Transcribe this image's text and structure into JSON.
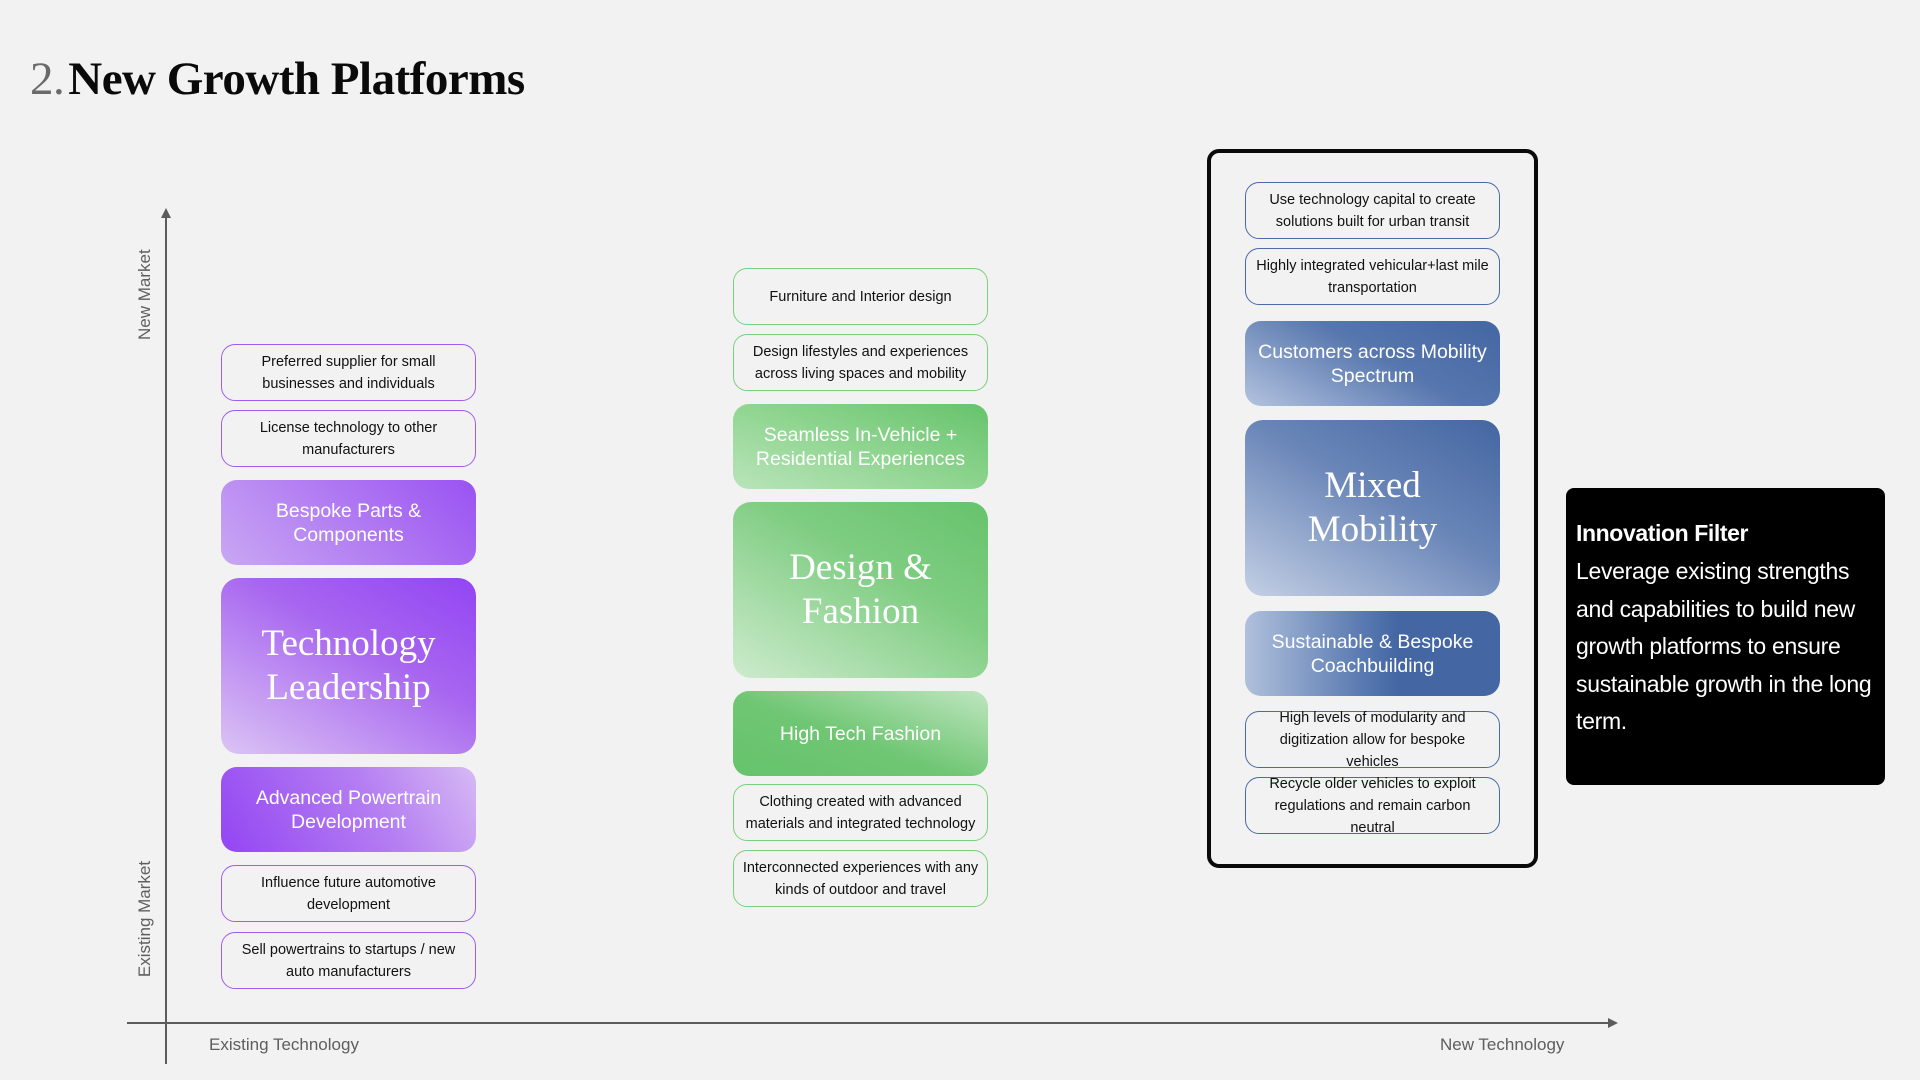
{
  "title": {
    "number": "2.",
    "text": "New Growth Platforms"
  },
  "axes": {
    "y_top_label": "New Market",
    "y_bottom_label": "Existing Market",
    "x_left_label": "Existing Technology",
    "x_right_label": "New Technology"
  },
  "columns": [
    {
      "name": "Technology Leadership",
      "color": "#9345f3",
      "items": [
        {
          "kind": "small",
          "text": "Preferred supplier for small businesses and individuals"
        },
        {
          "kind": "small",
          "text": "License technology to other manufacturers"
        },
        {
          "kind": "mid",
          "text": "Bespoke Parts & Components"
        },
        {
          "kind": "big",
          "text": "Technology Leadership"
        },
        {
          "kind": "mid",
          "text": "Advanced Powertrain Development"
        },
        {
          "kind": "small",
          "text": "Influence future automotive development"
        },
        {
          "kind": "small",
          "text": "Sell powertrains to startups / new auto manufacturers"
        }
      ]
    },
    {
      "name": "Design & Fashion",
      "color": "#66c36c",
      "items": [
        {
          "kind": "small",
          "text": "Furniture and Interior design"
        },
        {
          "kind": "small",
          "text": "Design lifestyles and experiences across living spaces and mobility"
        },
        {
          "kind": "mid",
          "text": "Seamless In-Vehicle + Residential Experiences"
        },
        {
          "kind": "big",
          "text": "Design & Fashion"
        },
        {
          "kind": "mid",
          "text": "High Tech Fashion"
        },
        {
          "kind": "small",
          "text": "Clothing created with advanced materials and integrated technology"
        },
        {
          "kind": "small",
          "text": "Interconnected experiences with any kinds of outdoor and travel"
        }
      ]
    },
    {
      "name": "Mixed Mobility",
      "color": "#4466a2",
      "highlighted": true,
      "items": [
        {
          "kind": "small",
          "text": "Use technology capital to create solutions built for urban transit"
        },
        {
          "kind": "small",
          "text": "Highly integrated vehicular+last mile transportation"
        },
        {
          "kind": "mid",
          "text": "Customers across Mobility Spectrum"
        },
        {
          "kind": "big",
          "text": "Mixed Mobility"
        },
        {
          "kind": "mid",
          "text": "Sustainable & Bespoke Coachbuilding"
        },
        {
          "kind": "small",
          "text": "High levels of modularity and digitization allow for bespoke vehicles"
        },
        {
          "kind": "small",
          "text": "Recycle older vehicles to exploit regulations and remain carbon neutral"
        }
      ]
    }
  ],
  "innovation_filter": {
    "title": "Innovation Filter",
    "body": "Leverage existing strengths and capabilities to build new growth platforms to ensure sustainable growth in the long term."
  }
}
